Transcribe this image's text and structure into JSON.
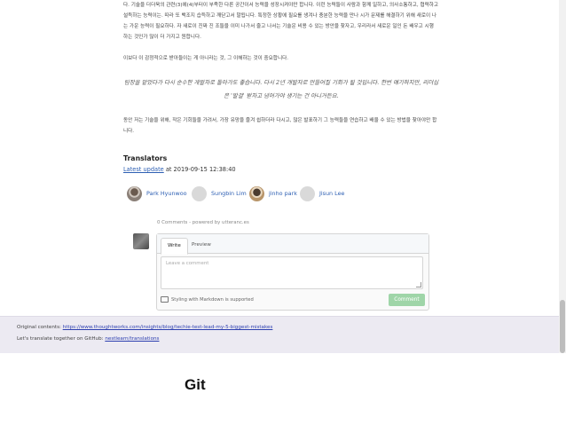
{
  "article": {
    "paragraph1": "다. 기술을 더더욱의 관련(3)에(4)부터이 부족한 다른 공간이서 능력을 성장시켜야만 합니다. 이런 능력들이 사람과 함께 일하고, 의사소통하고, 협력하고 설득하는 능력이는. 따라 또 백조지 습득하고 깨닫고서 말됩니다. 특정한 상황에 필요를 생겨나 충분한 능력을 만나 시가 문제를 해결하기 위해 새로이 나는 가운 능력이 필요하다. 자 새로이 진짜 진 조들을 이미 나가서 줄고 나서는 기술운 비용 수 있는 방안을 찾자고, 우리라서 새로운 일인 돈 배우고 시행 하는 것인가 많이 더 가지고 원합니다.",
    "paragraph2": "이보다 이 감정적으로 받아들이는 게 아니라는 것, 그 이해하는 것이 중요합니다.",
    "quote": "팀장을 맡았다가 다시 순수한 개발자로 돌아가도 좋습니다. 다시 2년 개발자로 만들어질 기회가 될 것입니다. 한번 얘기하지만, 리더십은 '발걸' 받자고 넘어가야 생기는 건 아니거든요.",
    "paragraph3": "동안 저는 기술을 위해, 작은 기회들을 가려서, 가장 유망을 즐겨 쉽하더라 다시고, 많은 발표하기 그 능력들을 연습하고 배울 수 있는 방법을 찾아야만 합니다."
  },
  "translators": {
    "title": "Translators",
    "latest_update_label": "Latest update",
    "latest_update_time": "at 2019-09-15 12:38:40",
    "people": [
      {
        "name": "Park Hyunwoo"
      },
      {
        "name": "Sungbin Lim"
      },
      {
        "name": "jinho park"
      },
      {
        "name": "Jisun Lee"
      }
    ]
  },
  "comments": {
    "header": "0 Comments - powered by utteranc.es",
    "tab_write": "Write",
    "tab_preview": "Preview",
    "textarea_placeholder": "Leave a comment",
    "markdown_note": "Styling with Markdown is supported",
    "comment_button": "Comment"
  },
  "footer": {
    "original_label": "Original contents:",
    "original_url": "https://www.thoughtworks.com/insights/blog/techie-test-lead-my-5-biggest-mistakes",
    "repo_label": "Let's translate together on GitHub:",
    "repo_url": "nestlearn/translations"
  },
  "bottom": {
    "title": "Git"
  },
  "colors": {
    "link": "#2d5fb3",
    "footer_bg": "#eceaf2",
    "comment_button": "#9fd5a8"
  }
}
